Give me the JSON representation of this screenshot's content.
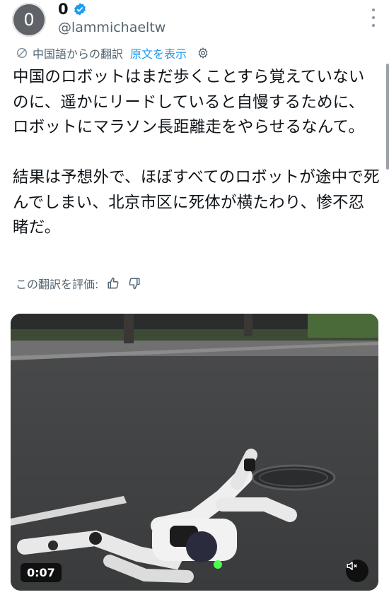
{
  "author": {
    "avatar_letter": "0",
    "display_name": "0",
    "handle": "@lammichaeltw",
    "verified": true
  },
  "translation": {
    "from_label": "中国語からの翻訳",
    "show_original": "原文を表示"
  },
  "tweet_text": "中国のロボットはまだ歩くことすら覚えていないのに、遥かにリードしていると自慢するために、ロボットにマラソン長距離走をやらせるなんて。\n\n結果は予想外で、ほぼすべてのロボットが途中で死んでしまい、北京市区に死体が横たわり、惨不忍睹だ。",
  "rating": {
    "label": "この翻訳を評価:"
  },
  "video": {
    "time": "0:07",
    "muted": true
  },
  "colors": {
    "link": "#1d9bf0",
    "verified": "#1d9bf0",
    "secondary_text": "#536471"
  },
  "icons": [
    "verified-badge-icon",
    "more-options-icon",
    "translate-icon",
    "gear-icon",
    "thumbs-up-icon",
    "thumbs-down-icon",
    "mute-icon"
  ]
}
